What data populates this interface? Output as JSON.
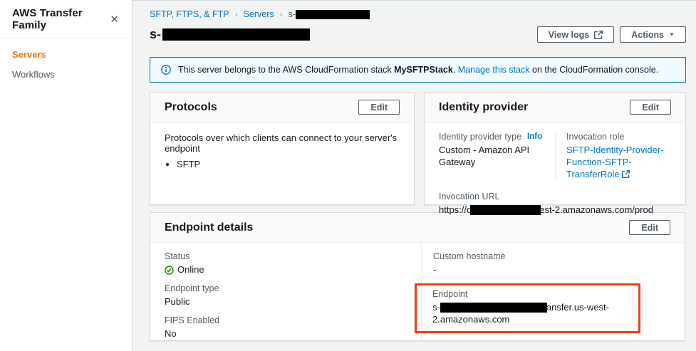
{
  "sidebar": {
    "title": "AWS Transfer Family",
    "items": [
      {
        "label": "Servers"
      },
      {
        "label": "Workflows"
      }
    ]
  },
  "header": {
    "breadcrumb": [
      {
        "label": "SFTP, FTPS, & FTP"
      },
      {
        "label": "Servers"
      },
      {
        "label": "s-"
      }
    ],
    "separator": "›",
    "title_prefix": "s-",
    "buttons": {
      "view_logs": "View logs",
      "actions": "Actions"
    }
  },
  "banner": {
    "text_before": "This server belongs to the AWS CloudFormation stack ",
    "stack_name": "MySFTPStack",
    "period": ". ",
    "link_text": "Manage this stack",
    "text_after": " on the CloudFormation console."
  },
  "protocols_card": {
    "title": "Protocols",
    "edit_label": "Edit",
    "description": "Protocols over which clients can connect to your server's endpoint",
    "items": [
      "SFTP"
    ]
  },
  "identity_card": {
    "title": "Identity provider",
    "edit_label": "Edit",
    "type_label": "Identity provider type",
    "info_label": "Info",
    "type_value": "Custom - Amazon API Gateway",
    "role_label": "Invocation role",
    "role_link": "SFTP-Identity-Provider-Function-SFTP-TransferRole",
    "url_label": "Invocation URL",
    "url_prefix": "https://d",
    "url_suffix": "est-2.amazonaws.com/prod"
  },
  "endpoint_card": {
    "title": "Endpoint details",
    "edit_label": "Edit",
    "status_label": "Status",
    "status_value": "Online",
    "hostname_label": "Custom hostname",
    "hostname_value": "-",
    "type_label": "Endpoint type",
    "type_value": "Public",
    "endpoint_label": "Endpoint",
    "endpoint_prefix": "s-",
    "endpoint_suffix": "ansfer.us-west-2.amazonaws.com",
    "fips_label": "FIPS Enabled",
    "fips_value": "No"
  },
  "colors": {
    "link_blue": "#0073bb",
    "active_nav_orange": "#ec7211",
    "status_green": "#1d8102",
    "highlight_red": "#e8401c",
    "banner_bg": "#f1faff"
  }
}
